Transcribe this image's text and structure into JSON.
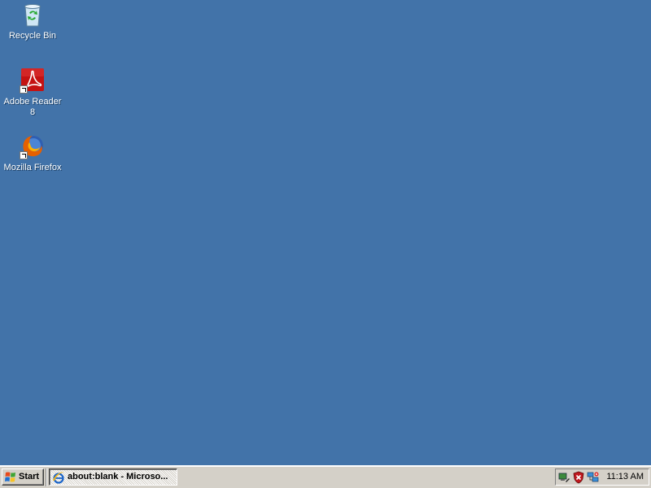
{
  "desktop": {
    "background_color": "#3a6ea5",
    "icons": [
      {
        "label": "Recycle Bin",
        "icon": "recycle-bin-icon"
      },
      {
        "label": "Adobe Reader 8",
        "icon": "adobe-reader-icon"
      },
      {
        "label": "Mozilla Firefox",
        "icon": "firefox-icon"
      }
    ]
  },
  "taskbar": {
    "start_label": "Start",
    "tasks": [
      {
        "label": "about:blank - Microso...",
        "icon": "internet-explorer-icon"
      }
    ],
    "tray": {
      "icons": [
        "network-icon",
        "security-shield-icon",
        "connection-icon"
      ],
      "clock": "11:13 AM"
    }
  }
}
